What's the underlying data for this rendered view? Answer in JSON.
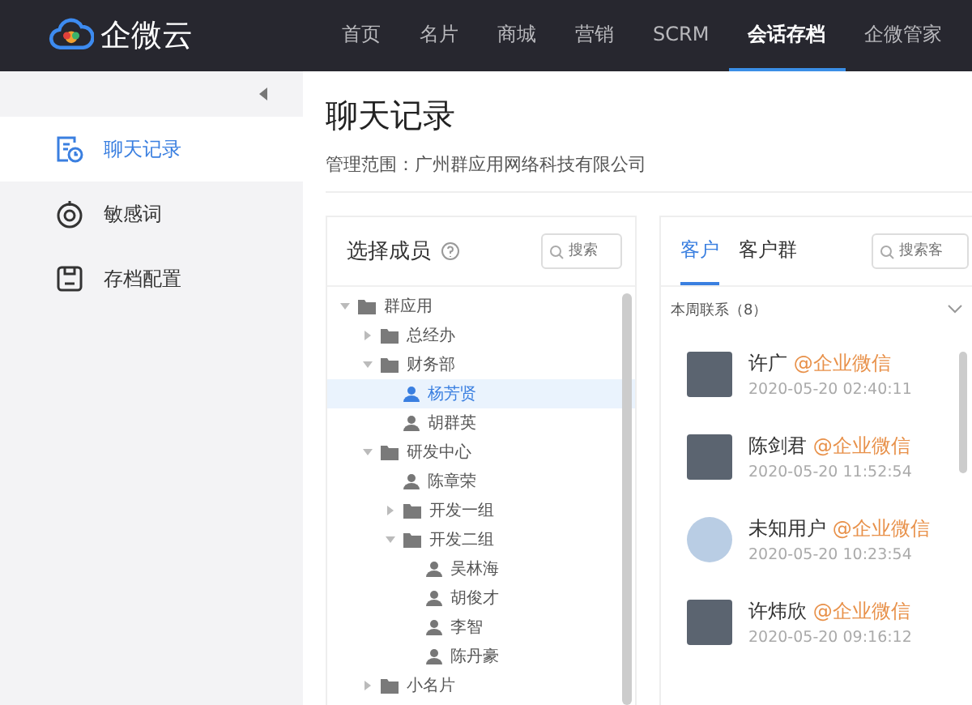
{
  "brand": {
    "name": "企微云"
  },
  "nav": [
    {
      "label": "首页",
      "selected": false
    },
    {
      "label": "名片",
      "selected": false
    },
    {
      "label": "商城",
      "selected": false
    },
    {
      "label": "营销",
      "selected": false
    },
    {
      "label": "SCRM",
      "selected": false
    },
    {
      "label": "会话存档",
      "selected": true
    },
    {
      "label": "企微管家",
      "selected": false
    }
  ],
  "sidebar": {
    "items": [
      {
        "label": "聊天记录",
        "kind": "chat",
        "selected": true
      },
      {
        "label": "敏感词",
        "kind": "sensitive",
        "selected": false
      },
      {
        "label": "存档配置",
        "kind": "config",
        "selected": false
      }
    ]
  },
  "page": {
    "title": "聊天记录",
    "scope": "管理范围：广州群应用网络科技有限公司"
  },
  "members": {
    "title": "选择成员",
    "search": {
      "placeholder": "搜索"
    },
    "tree": [
      {
        "label": "群应用",
        "kind": "folder",
        "expanded": true,
        "selected": false,
        "children": [
          {
            "label": "总经办",
            "kind": "folder",
            "expanded": false,
            "selected": false
          },
          {
            "label": "财务部",
            "kind": "folder",
            "expanded": true,
            "selected": false,
            "children": [
              {
                "label": "杨芳贤",
                "kind": "person",
                "selected": true
              },
              {
                "label": "胡群英",
                "kind": "person",
                "selected": false
              }
            ]
          },
          {
            "label": "研发中心",
            "kind": "folder",
            "expanded": true,
            "selected": false,
            "children": [
              {
                "label": "陈章荣",
                "kind": "person",
                "selected": false
              },
              {
                "label": "开发一组",
                "kind": "folder",
                "expanded": false,
                "selected": false
              },
              {
                "label": "开发二组",
                "kind": "folder",
                "expanded": true,
                "selected": false,
                "children": [
                  {
                    "label": "吴林海",
                    "kind": "person",
                    "selected": false
                  },
                  {
                    "label": "胡俊才",
                    "kind": "person",
                    "selected": false
                  },
                  {
                    "label": "李智",
                    "kind": "person",
                    "selected": false
                  },
                  {
                    "label": "陈丹豪",
                    "kind": "person",
                    "selected": false
                  }
                ]
              }
            ]
          },
          {
            "label": "小名片",
            "kind": "folder",
            "expanded": false,
            "selected": false
          }
        ]
      }
    ]
  },
  "customers": {
    "tabs": [
      {
        "label": "客户",
        "selected": true
      },
      {
        "label": "客户群",
        "selected": false
      }
    ],
    "search": {
      "placeholder": "搜索客"
    },
    "group": {
      "label": "本周联系（8）",
      "expanded": true
    },
    "contacts": [
      {
        "name": "许广",
        "tag": "@企业微信",
        "time": "2020-05-20 02:40:11",
        "kind": "photo"
      },
      {
        "name": "陈剑君",
        "tag": "@企业微信",
        "time": "2020-05-20 11:52:54",
        "kind": "photo"
      },
      {
        "name": "未知用户",
        "tag": "@企业微信",
        "time": "2020-05-20 10:23:54",
        "kind": "logo"
      },
      {
        "name": "许炜欣",
        "tag": "@企业微信",
        "time": "2020-05-20 09:16:12",
        "kind": "photo"
      }
    ]
  }
}
